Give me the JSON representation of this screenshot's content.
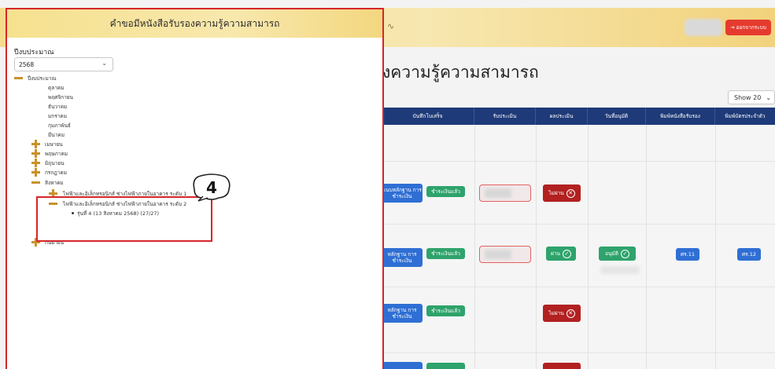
{
  "app": {
    "page_heading": "งความรู้ความสามารถ",
    "logout_label": "ออกจากระบบ",
    "show_select": "Show 20",
    "columns": [
      "บันทึกโบเสร็จ",
      "รับประเมิน",
      "ผลประเมิน",
      "วันที่อนุมัติ",
      "พิมพ์หนังสือรับรอง",
      "พิมพ์บัตรประจำตัว"
    ],
    "rows": [
      {
        "proof": "แนบหลักฐาน การชำระเงิน",
        "pay": "ชำระเงินแล้ว",
        "result": "ไม่ผ่าน",
        "approve": "",
        "cert": "",
        "card": ""
      },
      {
        "proof": "หลักฐาน การชำระเงิน",
        "pay": "ชำระเงินแล้ว",
        "result": "ผ่าน",
        "approve": "อนุมัติ",
        "cert": "ศร.11",
        "card": "ศร.12"
      },
      {
        "proof": "หลักฐาน การชำระเงิน",
        "pay": "ชำระเงินแล้ว",
        "result": "ไม่ผ่าน",
        "approve": "",
        "cert": "",
        "card": ""
      }
    ]
  },
  "panel": {
    "title": "คำขอมีหนังสือรับรองความรู้ความสามารถ",
    "fiscal_year_label": "ปีงบประมาณ",
    "fiscal_year_value": "2568",
    "tree": {
      "root": "ปีงบประมาณ",
      "months_plain": [
        "ตุลาคม",
        "พฤศจิกายน",
        "ธันวาคม",
        "มกราคม",
        "กุมภาพันธ์",
        "มีนาคม"
      ],
      "months_collapsed": [
        "เมษายน",
        "พฤษภาคม",
        "มิถุนายน",
        "กรกฎาคม"
      ],
      "expanded_month": "สิงหาคม",
      "courses": [
        "ไฟฟ้าและอิเล็กทรอนิกส์ ช่างไฟฟ้าภายในอาคาร ระดับ 1",
        "ไฟฟ้าและอิเล็กทรอนิกส์ ช่างไฟฟ้าภายในอาคาร ระดับ 2"
      ],
      "batch": "รุ่นที่ 4 (13 สิงหาคม 2568) (27/27)",
      "last_month": "กันยายน"
    }
  },
  "callout_number": "4",
  "colors": {
    "highlight": "#d6262a",
    "tree_toggle": "#c8922a",
    "table_header": "#1e3a78"
  }
}
